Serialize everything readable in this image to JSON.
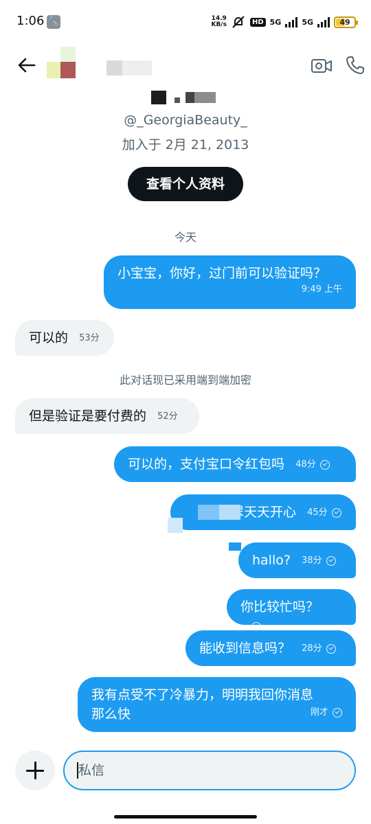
{
  "status_bar": {
    "time": "1:06",
    "net_speed_value": "14.9",
    "net_speed_unit": "KB/s",
    "hd_badge": "HD",
    "network_1": "5G",
    "network_2": "5G",
    "battery_level": "49",
    "battery_fraction": 0.49
  },
  "header": {
    "back_icon": "arrow-left-icon",
    "video_icon": "video-camera-icon",
    "phone_icon": "phone-icon"
  },
  "profile": {
    "handle": "@_GeorgiaBeauty_",
    "joined": "加入于 2月 21, 2013",
    "view_profile_label": "查看个人资料"
  },
  "conversation": {
    "day_divider": "今天",
    "encryption_note": "此对话现已采用端到端加密",
    "messages": [
      {
        "text": "小宝宝，你好，过门前可以验证吗？",
        "time": "9:49 上午"
      },
      {
        "text": "可以的",
        "time": "53分"
      },
      {
        "text": "但是验证是要付费的",
        "time": "52分"
      },
      {
        "text": "可以的，支付宝口令红包吗",
        "time": "48分"
      },
      {
        "text": "翠天天开心",
        "time": "45分"
      },
      {
        "text": "hallo?",
        "time": "38分"
      },
      {
        "text": "你比较忙吗？",
        "time": ""
      },
      {
        "text": "能收到信息吗？",
        "time": "28分"
      },
      {
        "text": "我有点受不了冷暴力，明明我回你消息那么快",
        "time": "刚才"
      }
    ]
  },
  "composer": {
    "add_icon": "plus-icon",
    "placeholder": "私信"
  },
  "colors": {
    "accent": "#1d9bf0",
    "received_bubble": "#eff3f4",
    "primary_button": "#0f1419"
  }
}
